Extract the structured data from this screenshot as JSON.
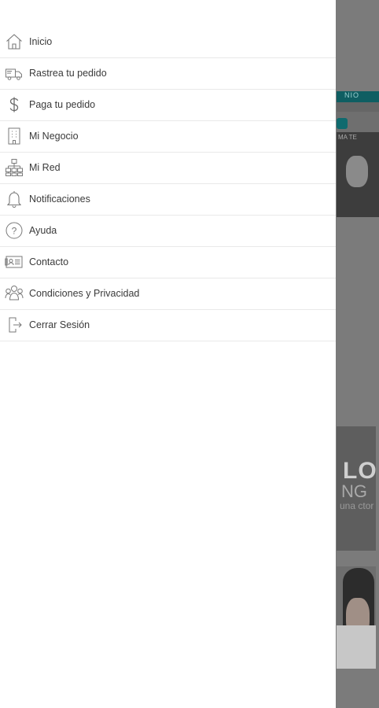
{
  "drawer": {
    "items": [
      {
        "label": "Inicio",
        "icon": "home-icon"
      },
      {
        "label": "Rastrea tu pedido",
        "icon": "delivery-truck-icon"
      },
      {
        "label": "Paga tu pedido",
        "icon": "dollar-icon"
      },
      {
        "label": "Mi Negocio",
        "icon": "building-icon"
      },
      {
        "label": "Mi Red",
        "icon": "network-icon"
      },
      {
        "label": "Notificaciones",
        "icon": "bell-icon"
      },
      {
        "label": "Ayuda",
        "icon": "help-icon"
      },
      {
        "label": "Contacto",
        "icon": "contact-card-icon"
      },
      {
        "label": "Condiciones y Privacidad",
        "icon": "group-icon"
      },
      {
        "label": "Cerrar Sesión",
        "icon": "logout-icon"
      }
    ]
  },
  "background": {
    "banner_text_1": "LO",
    "banner_text_2": "NG",
    "banner_text_3": "una ctor",
    "promo_text_1": "NIO",
    "promo_text_2": "MA TE"
  }
}
